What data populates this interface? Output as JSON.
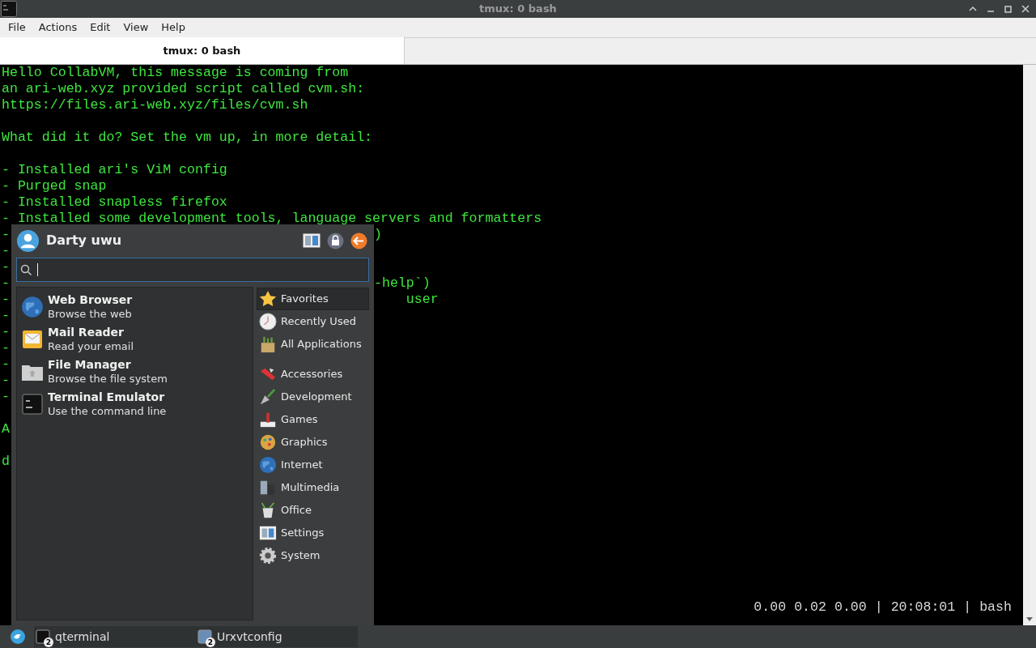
{
  "window": {
    "title": "tmux: 0 bash",
    "menu": [
      "File",
      "Actions",
      "Edit",
      "View",
      "Help"
    ],
    "tabs": [
      {
        "label": "tmux: 0 bash",
        "selected": true
      }
    ]
  },
  "terminal": {
    "blocks": [
      [
        "Hello CollabVM, this message is coming from",
        "an ari-web.xyz provided script called cvm.sh:",
        "https://files.ari-web.xyz/files/cvm.sh"
      ],
      [
        "What did it do? Set the vm up, in more detail:"
      ],
      [
        "- Installed ari's ViM config",
        "- Purged snap",
        "- Installed snapless firefox",
        "- Installed some development tools, language servers and formatters",
        {
          "text": "-",
          "right": ")"
        },
        {
          "text": "-"
        },
        {
          "text": "-"
        },
        {
          "text": "-",
          "right": "-help`)"
        },
        {
          "text": "-",
          "right": "    user"
        },
        {
          "text": "-"
        },
        {
          "text": "-"
        },
        {
          "text": "-"
        },
        {
          "text": "-"
        },
        {
          "text": "-"
        },
        {
          "text": "-"
        }
      ],
      [
        "A"
      ],
      [
        "d"
      ]
    ],
    "status_line": "0.00 0.02 0.00 | 20:08:01 | bash"
  },
  "app_menu": {
    "user": "Darty uwu",
    "favorites": [
      {
        "name": "Web Browser",
        "description": "Browse the web"
      },
      {
        "name": "Mail Reader",
        "description": "Read your email"
      },
      {
        "name": "File Manager",
        "description": "Browse the file system"
      },
      {
        "name": "Terminal Emulator",
        "description": "Use the command line"
      }
    ],
    "places": [
      {
        "label": "Favorites",
        "selected": true
      },
      {
        "label": "Recently Used",
        "selected": false
      },
      {
        "label": "All Applications",
        "selected": false
      }
    ],
    "categories": [
      {
        "label": "Accessories",
        "selected": false
      },
      {
        "label": "Development",
        "selected": false
      },
      {
        "label": "Games",
        "selected": false
      },
      {
        "label": "Graphics",
        "selected": false
      },
      {
        "label": "Internet",
        "selected": false
      },
      {
        "label": "Multimedia",
        "selected": false
      },
      {
        "label": "Office",
        "selected": false
      },
      {
        "label": "Settings",
        "selected": false
      },
      {
        "label": "System",
        "selected": false
      }
    ]
  },
  "taskbar": {
    "items": [
      {
        "label": "qterminal",
        "badge": "2"
      },
      {
        "label": "Urxvtconfig",
        "badge": "2"
      }
    ]
  }
}
